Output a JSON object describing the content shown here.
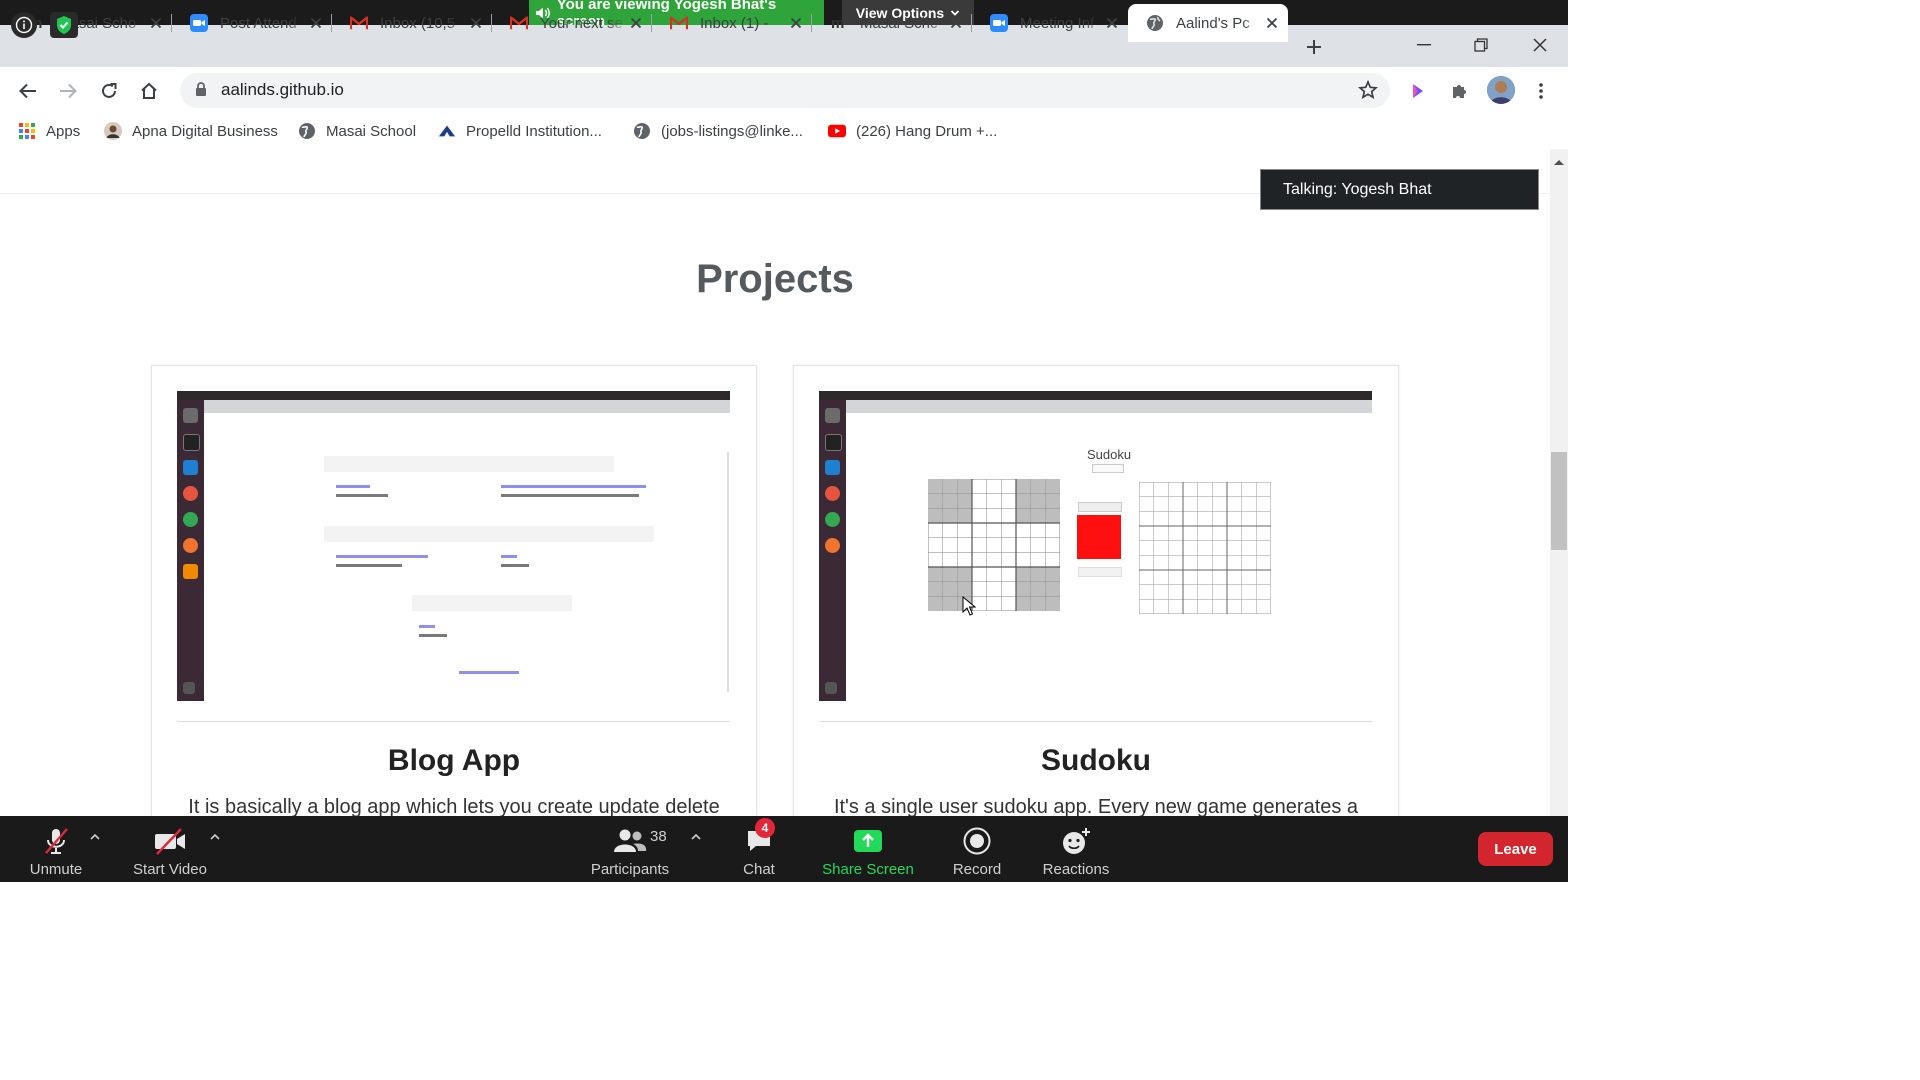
{
  "zoom": {
    "viewing_banner": "You are viewing Yogesh Bhat's screen",
    "view_options": "View Options",
    "talking": "Talking: Yogesh Bhat",
    "controls": {
      "unmute": "Unmute",
      "start_video": "Start Video",
      "participants": "Participants",
      "participants_count": "38",
      "chat": "Chat",
      "chat_badge": "4",
      "share_screen": "Share Screen",
      "record": "Record",
      "reactions": "Reactions",
      "leave": "Leave"
    },
    "colors": {
      "banner_green": "#2fa43a",
      "share_green": "#23d959",
      "leave_red": "#d2252d"
    }
  },
  "browser": {
    "tabs": [
      {
        "title": "Masai Scho",
        "icon": "masai-m-icon"
      },
      {
        "title": "Post Attend",
        "icon": "zoom-icon"
      },
      {
        "title": "Inbox (10,5",
        "icon": "gmail-icon"
      },
      {
        "title": "Your next se",
        "icon": "gmail-icon"
      },
      {
        "title": "Inbox (1) - ",
        "icon": "gmail-icon"
      },
      {
        "title": "Masai Schc",
        "icon": "masai-m-icon"
      },
      {
        "title": "Meeting Inf",
        "icon": "zoom-icon"
      },
      {
        "title": "Aalind's Pc",
        "icon": "globe-icon",
        "active": true
      }
    ],
    "url": "aalinds.github.io",
    "bookmarks": [
      {
        "label": "Apps",
        "icon": "apps-grid-icon"
      },
      {
        "label": "Apna Digital Business",
        "icon": "person-avatar-icon"
      },
      {
        "label": "Masai School",
        "icon": "globe-icon"
      },
      {
        "label": "Propelld Institution...",
        "icon": "propelld-icon"
      },
      {
        "label": "(jobs-listings@linke...",
        "icon": "globe-icon"
      },
      {
        "label": "(226) Hang Drum +...",
        "icon": "youtube-icon"
      }
    ]
  },
  "page": {
    "section_title": "Projects",
    "projects": [
      {
        "title": "Blog App",
        "description": "It is basically a blog app which lets you create update delete"
      },
      {
        "title": "Sudoku",
        "description": "It's a single user sudoku app. Every new game generates a"
      }
    ],
    "sudoku_shot_heading": "Sudoku"
  }
}
